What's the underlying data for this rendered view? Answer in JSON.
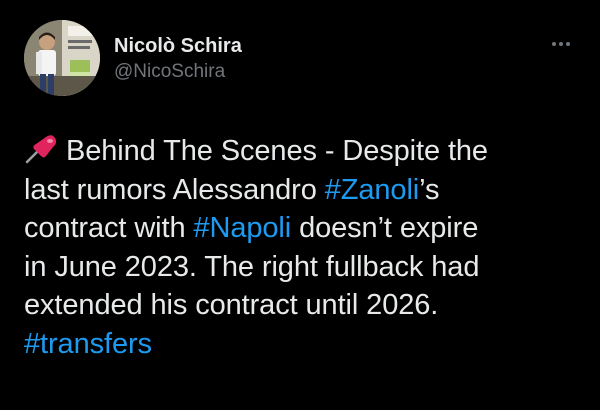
{
  "author": {
    "display_name": "Nicolò Schira",
    "handle": "@NicoSchira",
    "avatar_icon": "profile-photo"
  },
  "menu": {
    "icon": "more-options-icon"
  },
  "tweet": {
    "emoji_icon": "pushpin-icon",
    "lines": [
      {
        "parts": [
          {
            "text": "Behind The Scenes - Despite the"
          }
        ]
      },
      {
        "parts": [
          {
            "text": "last rumors Alessandro "
          },
          {
            "text": "#Zanoli",
            "hashtag": true
          },
          {
            "text": "’s"
          }
        ]
      },
      {
        "parts": [
          {
            "text": "contract with "
          },
          {
            "text": "#Napoli",
            "hashtag": true
          },
          {
            "text": " doesn’t expire"
          }
        ]
      },
      {
        "parts": [
          {
            "text": "in June 2023. The right fullback had"
          }
        ]
      },
      {
        "parts": [
          {
            "text": "extended his contract until 2026."
          }
        ]
      },
      {
        "parts": [
          {
            "text": "#transfers",
            "hashtag": true
          }
        ]
      }
    ]
  },
  "colors": {
    "background": "#000000",
    "text": "#e7e9ea",
    "secondary": "#71767b",
    "hashtag": "#1d9bf0"
  }
}
